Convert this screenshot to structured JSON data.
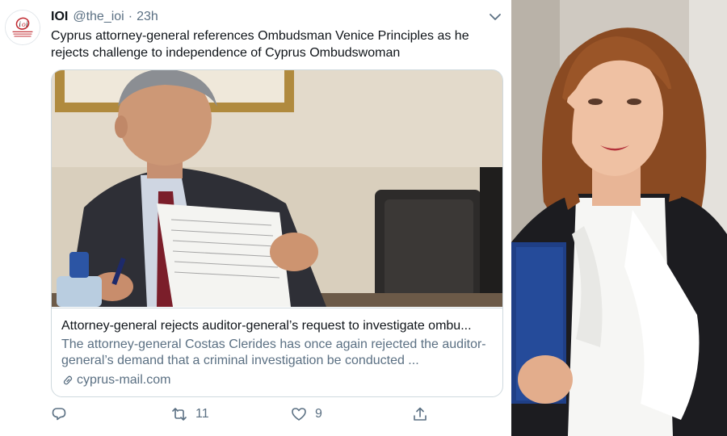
{
  "tweet": {
    "author_name": "IOI",
    "author_handle": "@the_ioi",
    "separator": "·",
    "time": "23h",
    "text": "Cyprus attorney-general references Ombudsman Venice Principles as he rejects challenge to independence of Cyprus Ombudswoman",
    "card": {
      "title": "Attorney-general rejects auditor-general’s request to investigate ombu...",
      "description": "The attorney-general Costas Clerides has once again rejected the auditor-general’s demand that a criminal investigation be conducted ...",
      "domain": "cyprus-mail.com"
    },
    "actions": {
      "reply_icon": "reply-icon",
      "retweet_icon": "retweet-icon",
      "retweet_count": "11",
      "like_icon": "heart-icon",
      "like_count": "9",
      "share_icon": "share-icon"
    }
  },
  "colors": {
    "text_primary": "#0f1419",
    "text_secondary": "#5b7083",
    "border": "#cfd9de",
    "logo_red": "#c0262d"
  }
}
